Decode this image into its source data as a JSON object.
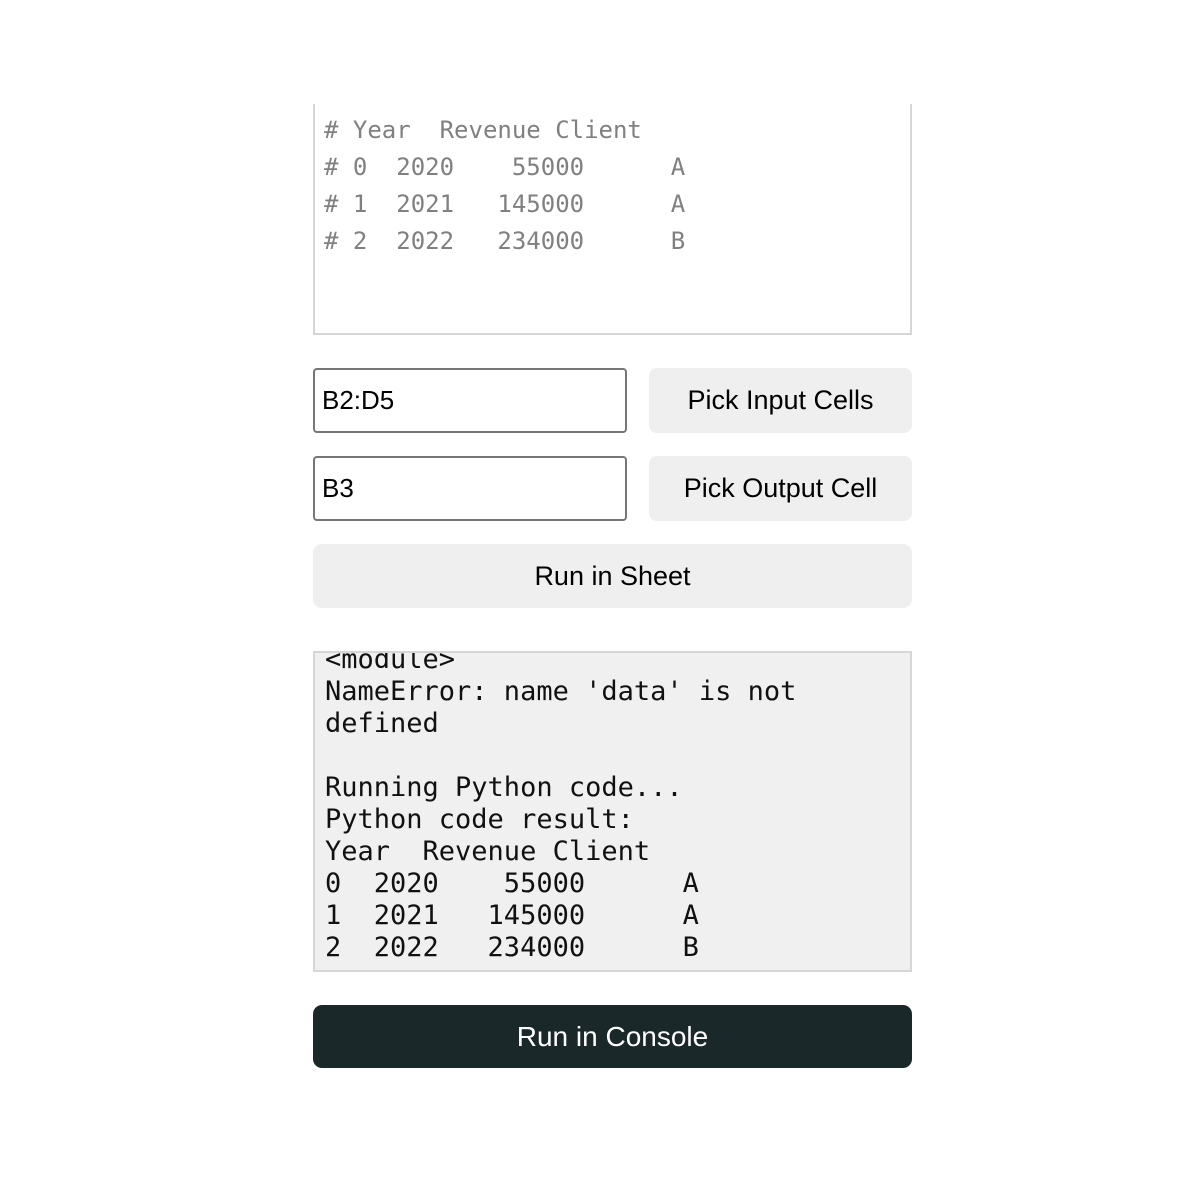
{
  "code_editor": {
    "lines": [
      "# Year  Revenue Client",
      "# 0  2020    55000      A",
      "# 1  2021   145000      A",
      "# 2  2022   234000      B"
    ]
  },
  "input_cells": {
    "value": "B2:D5",
    "button_label": "Pick Input Cells"
  },
  "output_cell": {
    "value": "B3",
    "button_label": "Pick Output Cell"
  },
  "run_sheet_label": "Run in Sheet",
  "console": {
    "lines": [
      "<module>",
      "NameError: name 'data' is not",
      "defined",
      "",
      "Running Python code...",
      "Python code result:",
      "Year  Revenue Client",
      "0  2020    55000      A",
      "1  2021   145000      A",
      "2  2022   234000      B"
    ]
  },
  "run_console_label": "Run in Console",
  "colors": {
    "primary_button_bg": "#1b2829",
    "secondary_button_bg": "#efefef",
    "console_bg": "#f0f0f0",
    "code_comment": "#808080"
  }
}
